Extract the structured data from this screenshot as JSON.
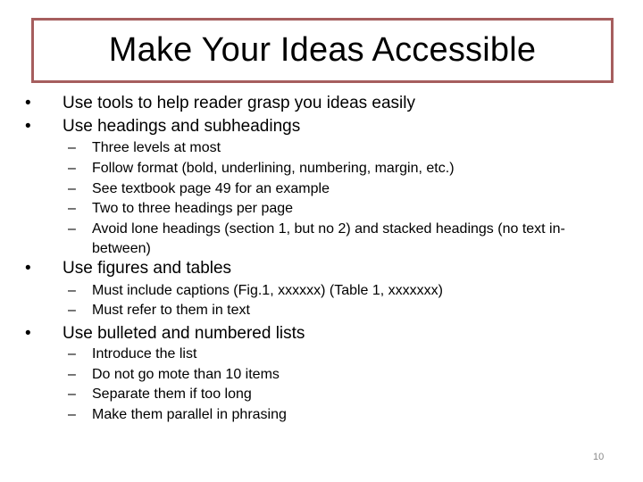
{
  "slide": {
    "title": "Make Your Ideas Accessible",
    "accent_color": "#a65e5e",
    "page_number": "10",
    "bullet_glyph": "•",
    "dash_glyph": "–",
    "top_bullets": [
      "Use tools to help reader grasp you ideas easily",
      "Use headings and subheadings"
    ],
    "headings_subitems": [
      "Three levels at most",
      "Follow format (bold, underlining, numbering, margin, etc.)",
      "See textbook page 49 for an example",
      "Two to three headings per page",
      "Avoid lone headings (section 1, but no 2) and stacked headings (no text in-between)"
    ],
    "figures": {
      "label": "Use figures and tables",
      "subitems": [
        "Must include captions (Fig.1, xxxxxx) (Table 1, xxxxxxx)",
        "Must refer to them in text"
      ]
    },
    "lists": {
      "label": "Use bulleted  and numbered lists",
      "subitems": [
        "Introduce the list",
        "Do not go mote than 10 items",
        "Separate them if too long",
        "Make them parallel in phrasing"
      ]
    }
  }
}
